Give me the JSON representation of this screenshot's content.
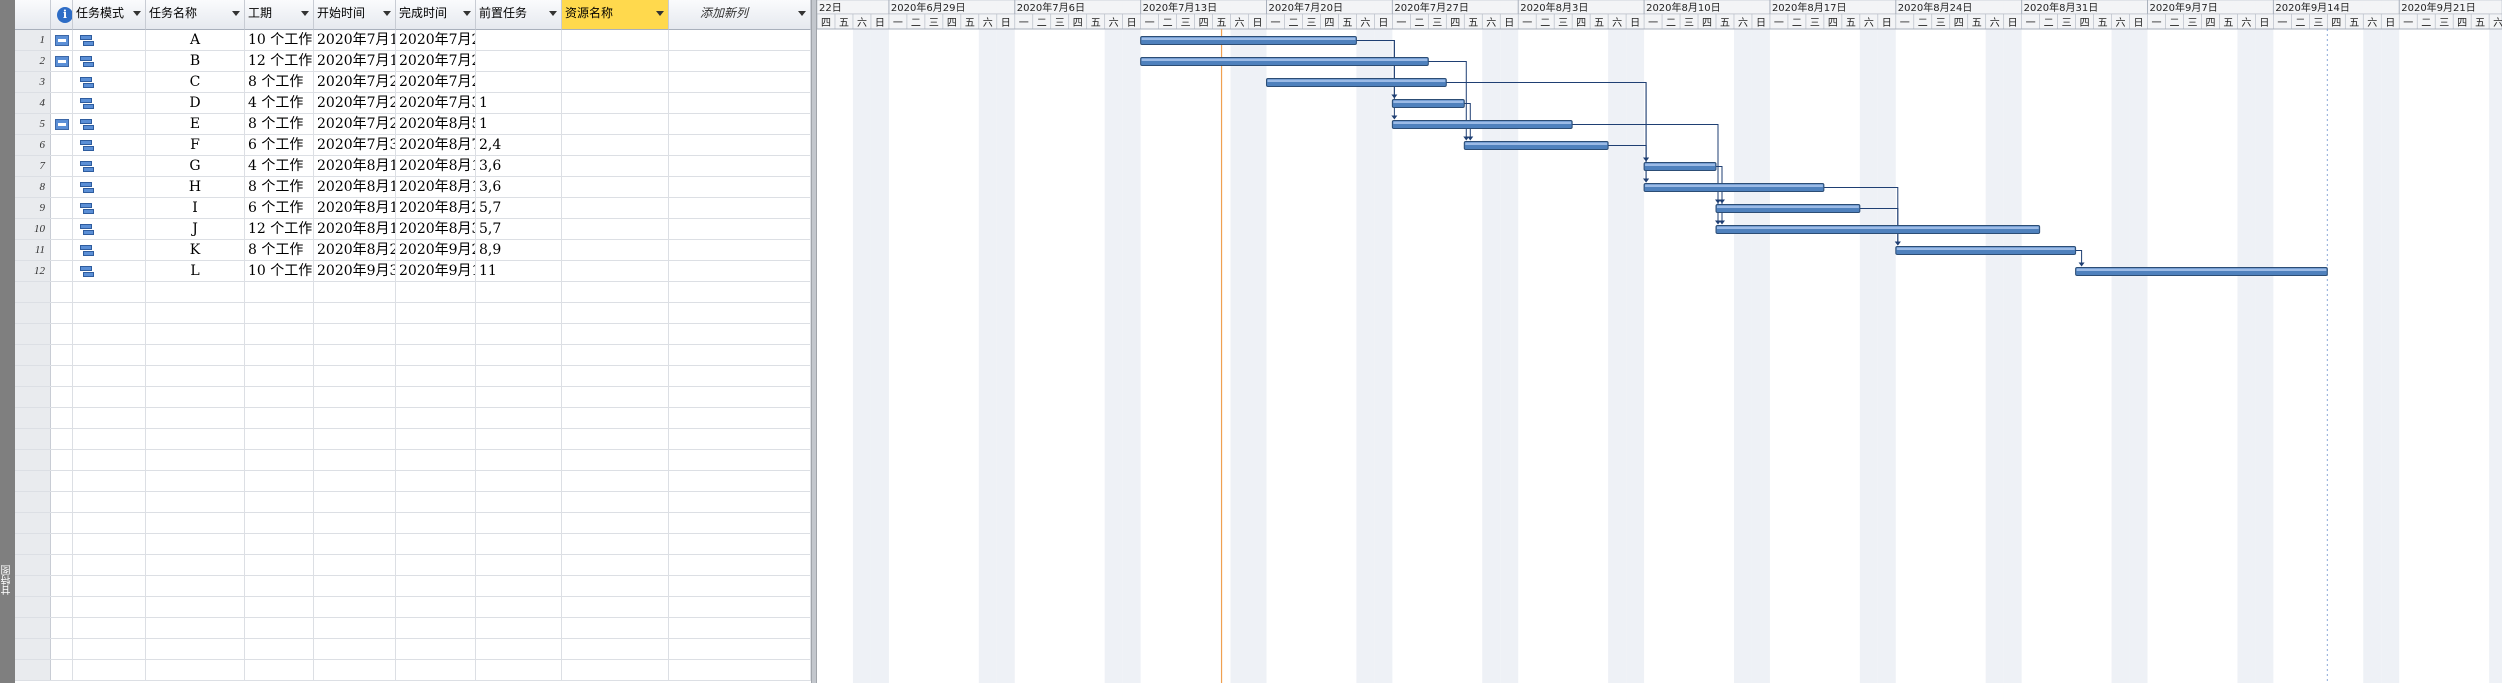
{
  "view_label": "甘特图",
  "columns": [
    {
      "key": "indicator",
      "label": ""
    },
    {
      "key": "mode",
      "label": "任务模式"
    },
    {
      "key": "name",
      "label": "任务名称"
    },
    {
      "key": "duration",
      "label": "工期"
    },
    {
      "key": "start",
      "label": "开始时间"
    },
    {
      "key": "finish",
      "label": "完成时间"
    },
    {
      "key": "pred",
      "label": "前置任务"
    },
    {
      "key": "resource",
      "label": "资源名称"
    },
    {
      "key": "addcol",
      "label": "添加新列"
    }
  ],
  "tasks": [
    {
      "id": "1",
      "indicator": true,
      "name": "A",
      "duration": "10 个工作",
      "start": "2020年7月1",
      "finish": "2020年7月2",
      "pred": ""
    },
    {
      "id": "2",
      "indicator": true,
      "name": "B",
      "duration": "12 个工作",
      "start": "2020年7月1",
      "finish": "2020年7月2",
      "pred": ""
    },
    {
      "id": "3",
      "indicator": false,
      "name": "C",
      "duration": "8 个工作",
      "start": "2020年7月2",
      "finish": "2020年7月2",
      "pred": ""
    },
    {
      "id": "4",
      "indicator": false,
      "name": "D",
      "duration": "4 个工作",
      "start": "2020年7月2",
      "finish": "2020年7月3",
      "pred": "1"
    },
    {
      "id": "5",
      "indicator": true,
      "name": "E",
      "duration": "8 个工作",
      "start": "2020年7月2",
      "finish": "2020年8月5",
      "pred": "1"
    },
    {
      "id": "6",
      "indicator": false,
      "name": "F",
      "duration": "6 个工作",
      "start": "2020年7月3",
      "finish": "2020年8月7",
      "pred": "2,4"
    },
    {
      "id": "7",
      "indicator": false,
      "name": "G",
      "duration": "4 个工作",
      "start": "2020年8月1",
      "finish": "2020年8月1",
      "pred": "3,6"
    },
    {
      "id": "8",
      "indicator": false,
      "name": "H",
      "duration": "8 个工作",
      "start": "2020年8月1",
      "finish": "2020年8月1",
      "pred": "3,6"
    },
    {
      "id": "9",
      "indicator": false,
      "name": "I",
      "duration": "6 个工作",
      "start": "2020年8月1",
      "finish": "2020年8月2",
      "pred": "5,7"
    },
    {
      "id": "10",
      "indicator": false,
      "name": "J",
      "duration": "12 个工作",
      "start": "2020年8月1",
      "finish": "2020年8月3",
      "pred": "5,7"
    },
    {
      "id": "11",
      "indicator": false,
      "name": "K",
      "duration": "8 个工作",
      "start": "2020年8月2",
      "finish": "2020年9月2",
      "pred": "8,9"
    },
    {
      "id": "12",
      "indicator": false,
      "name": "L",
      "duration": "10 个工作",
      "start": "2020年9月3",
      "finish": "2020年9月1",
      "pred": "11"
    }
  ],
  "timeline": {
    "weeks": [
      "22日",
      "2020年6月29日",
      "2020年7月6日",
      "2020年7月13日",
      "2020年7月20日",
      "2020年7月27日",
      "2020年8月3日",
      "2020年8月10日",
      "2020年8月17日",
      "2020年8月24日",
      "2020年8月31日",
      "2020年9月7日",
      "2020年9月14日",
      "2020年9月21日"
    ],
    "day_labels": [
      "一",
      "二",
      "三",
      "四",
      "五",
      "六",
      "日"
    ],
    "lead_days": [
      "四",
      "五",
      "六",
      "日"
    ],
    "first_day": "2020-06-25",
    "today": "2020-07-17",
    "bars": [
      {
        "task": "A",
        "start": "2020-07-13",
        "finish": "2020-07-24"
      },
      {
        "task": "B",
        "start": "2020-07-13",
        "finish": "2020-07-28"
      },
      {
        "task": "C",
        "start": "2020-07-20",
        "finish": "2020-07-29"
      },
      {
        "task": "D",
        "start": "2020-07-27",
        "finish": "2020-07-30"
      },
      {
        "task": "E",
        "start": "2020-07-27",
        "finish": "2020-08-05"
      },
      {
        "task": "F",
        "start": "2020-07-31",
        "finish": "2020-08-07"
      },
      {
        "task": "G",
        "start": "2020-08-10",
        "finish": "2020-08-13"
      },
      {
        "task": "H",
        "start": "2020-08-10",
        "finish": "2020-08-19"
      },
      {
        "task": "I",
        "start": "2020-08-14",
        "finish": "2020-08-21"
      },
      {
        "task": "J",
        "start": "2020-08-14",
        "finish": "2020-08-31"
      },
      {
        "task": "K",
        "start": "2020-08-24",
        "finish": "2020-09-02"
      },
      {
        "task": "L",
        "start": "2020-09-03",
        "finish": "2020-09-16"
      }
    ],
    "links": [
      {
        "from": "A",
        "to": "D"
      },
      {
        "from": "A",
        "to": "E"
      },
      {
        "from": "B",
        "to": "F"
      },
      {
        "from": "D",
        "to": "F"
      },
      {
        "from": "C",
        "to": "G"
      },
      {
        "from": "F",
        "to": "G"
      },
      {
        "from": "C",
        "to": "H"
      },
      {
        "from": "F",
        "to": "H"
      },
      {
        "from": "E",
        "to": "I"
      },
      {
        "from": "G",
        "to": "I"
      },
      {
        "from": "E",
        "to": "J"
      },
      {
        "from": "G",
        "to": "J"
      },
      {
        "from": "H",
        "to": "K"
      },
      {
        "from": "I",
        "to": "K"
      },
      {
        "from": "K",
        "to": "L"
      }
    ]
  },
  "colors": {
    "bar_fill": "#4f81bd",
    "bar_stroke": "#2c4d75",
    "link": "#1f3f73",
    "weekend": "#eef1f6",
    "today": "#f0a050",
    "resource_header": "#ffd94d"
  }
}
